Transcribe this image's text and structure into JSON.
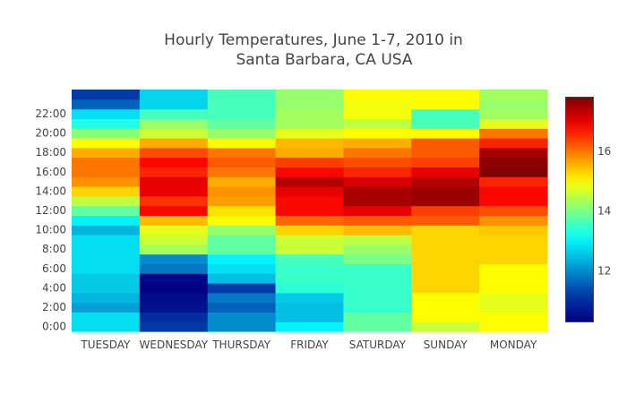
{
  "chart_data": {
    "type": "heatmap",
    "title_lines": [
      "Hourly Temperatures, June 1-7, 2010 in",
      "Santa Barbara, CA USA"
    ],
    "x_categories": [
      "TUESDAY",
      "WEDNESDAY",
      "THURSDAY",
      "FRIDAY",
      "SATURDAY",
      "SUNDAY",
      "MONDAY"
    ],
    "y_tick_labels": [
      "0:00",
      "2:00",
      "4:00",
      "6:00",
      "8:00",
      "10:00",
      "12:00",
      "14:00",
      "16:00",
      "18:00",
      "20:00",
      "22:00"
    ],
    "hours": [
      0,
      1,
      2,
      3,
      4,
      5,
      6,
      7,
      8,
      9,
      10,
      11,
      12,
      13,
      14,
      15,
      16,
      17,
      18,
      19,
      20,
      21,
      22,
      23
    ],
    "colorscale": "Jet",
    "zmin": 10.3,
    "zmax": 17.8,
    "colorbar_ticks": [
      12,
      14,
      16
    ],
    "z": [
      [
        12.8,
        11.2,
        12.0,
        13.0,
        13.8,
        14.6,
        15.0
      ],
      [
        12.8,
        11.0,
        12.0,
        12.5,
        13.8,
        15.0,
        15.0
      ],
      [
        12.2,
        10.6,
        11.6,
        12.5,
        13.5,
        15.0,
        14.8
      ],
      [
        12.4,
        10.5,
        11.8,
        12.6,
        13.5,
        15.0,
        14.8
      ],
      [
        12.6,
        10.3,
        11.2,
        13.4,
        13.5,
        15.3,
        15.0
      ],
      [
        12.6,
        10.4,
        12.5,
        13.5,
        13.5,
        15.3,
        15.0
      ],
      [
        12.8,
        11.8,
        12.8,
        13.5,
        13.5,
        15.3,
        15.0
      ],
      [
        12.8,
        12.0,
        13.0,
        13.6,
        14.0,
        15.3,
        15.3
      ],
      [
        12.8,
        14.3,
        13.8,
        14.6,
        14.2,
        15.3,
        15.3
      ],
      [
        12.8,
        14.6,
        13.8,
        14.6,
        14.5,
        15.3,
        15.3
      ],
      [
        12.4,
        14.8,
        14.2,
        15.3,
        15.5,
        15.3,
        15.4
      ],
      [
        13.0,
        15.5,
        15.0,
        16.1,
        16.2,
        16.2,
        15.8
      ],
      [
        13.8,
        16.8,
        15.2,
        16.8,
        17.0,
        16.4,
        16.3
      ],
      [
        14.5,
        16.5,
        15.7,
        16.8,
        17.5,
        17.6,
        16.8
      ],
      [
        15.3,
        17.0,
        15.8,
        17.0,
        17.5,
        17.6,
        16.8
      ],
      [
        15.8,
        17.0,
        15.6,
        17.4,
        17.1,
        17.4,
        16.6
      ],
      [
        16.0,
        16.6,
        16.0,
        16.8,
        16.6,
        17.0,
        17.8
      ],
      [
        16.0,
        16.8,
        16.2,
        16.4,
        16.3,
        16.4,
        17.7
      ],
      [
        15.6,
        16.3,
        16.0,
        15.6,
        16.0,
        16.2,
        17.5
      ],
      [
        15.0,
        15.6,
        15.0,
        15.5,
        15.6,
        16.2,
        16.6
      ],
      [
        14.1,
        14.6,
        14.2,
        14.8,
        15.0,
        15.0,
        16.0
      ],
      [
        13.3,
        14.2,
        13.8,
        14.3,
        14.5,
        13.6,
        14.8
      ],
      [
        12.8,
        13.6,
        13.6,
        14.3,
        14.9,
        13.6,
        14.3
      ],
      [
        11.6,
        12.7,
        13.6,
        14.2,
        14.9,
        15.0,
        14.2
      ],
      [
        11.2,
        12.7,
        13.6,
        14.2,
        15.0,
        15.0,
        14.3
      ]
    ]
  }
}
